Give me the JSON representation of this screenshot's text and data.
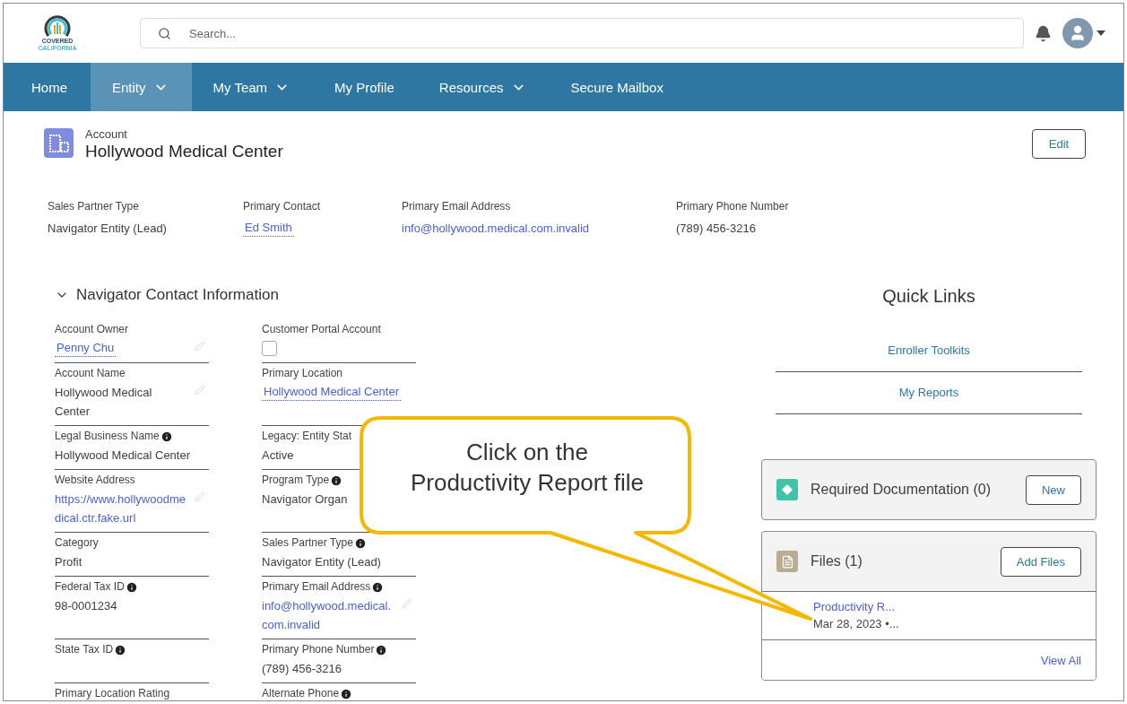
{
  "logo": {
    "line_1": "COVERED",
    "line_2": "CALIFORNIA"
  },
  "search": {
    "placeholder": "Search..."
  },
  "nav": [
    {
      "label": "Home",
      "selected": false,
      "dropdown": false
    },
    {
      "label": "Entity",
      "selected": true,
      "dropdown": true
    },
    {
      "label": "My Team",
      "selected": false,
      "dropdown": true
    },
    {
      "label": "My Profile",
      "selected": false,
      "dropdown": false
    },
    {
      "label": "Resources",
      "selected": false,
      "dropdown": true
    },
    {
      "label": "Secure Mailbox",
      "selected": false,
      "dropdown": false
    }
  ],
  "record": {
    "type": "Account",
    "name": "Hollywood Medical Center",
    "edit_button": "Edit"
  },
  "highlights": [
    {
      "label": "Sales Partner Type",
      "value": "Navigator Entity (Lead)",
      "kind": "text"
    },
    {
      "label": "Primary Contact",
      "value": "Ed Smith",
      "kind": "lookup"
    },
    {
      "label": "Primary Email Address",
      "value": "info@hollywood.medical.com.invalid",
      "kind": "link"
    },
    {
      "label": "Primary Phone Number",
      "value": "(789) 456-3216",
      "kind": "text"
    }
  ],
  "section": {
    "title": "Navigator Contact Information",
    "expanded": true,
    "fields": [
      {
        "label": "Account Owner",
        "value": "Penny Chu",
        "kind": "lookup",
        "info": false,
        "editable": true
      },
      {
        "label": "Customer Portal Account",
        "kind": "checkbox",
        "checked": false,
        "info": false,
        "editable": false
      },
      {
        "label": "Account Name",
        "value": "Hollywood Medical Center",
        "kind": "text",
        "info": false,
        "editable": true
      },
      {
        "label": "Primary Location",
        "value": "Hollywood Medical Center",
        "kind": "lookup",
        "info": false,
        "editable": false
      },
      {
        "label": "Legal Business Name",
        "value": "Hollywood Medical Center",
        "kind": "text",
        "info": true,
        "editable": false
      },
      {
        "label": "Legacy: Entity Stat",
        "value": "Active",
        "kind": "text",
        "info": false,
        "editable": false
      },
      {
        "label": "Website Address",
        "value": "https://www.hollywoodmedical.ctr.fake.url",
        "kind": "link",
        "info": false,
        "editable": true
      },
      {
        "label": "Program Type",
        "value": "Navigator Organ",
        "kind": "text",
        "info": true,
        "editable": false
      },
      {
        "label": "Category",
        "value": "Profit",
        "kind": "text",
        "info": false,
        "editable": false
      },
      {
        "label": "Sales Partner Type",
        "value": "Navigator Entity (Lead)",
        "kind": "text",
        "info": true,
        "editable": false
      },
      {
        "label": "Federal Tax ID",
        "value": "98-0001234",
        "kind": "text",
        "info": true,
        "editable": false
      },
      {
        "label": "Primary Email Address",
        "value": "info@hollywood.medical.com.invalid",
        "kind": "link",
        "info": true,
        "editable": true
      },
      {
        "label": "State Tax ID",
        "kind": "text",
        "info": true,
        "editable": false
      },
      {
        "label": "Primary Phone Number",
        "value": "(789) 456-3216",
        "kind": "text",
        "info": true,
        "editable": false
      },
      {
        "label": "Primary Location Rating",
        "kind": "text",
        "info": false,
        "editable": false
      },
      {
        "label": "Alternate Phone",
        "kind": "text",
        "info": true,
        "editable": false
      }
    ]
  },
  "quick_links": {
    "title": "Quick Links",
    "links": [
      "Enroller Toolkits",
      "My Reports"
    ]
  },
  "required_docs": {
    "title": "Required Documentation (0)",
    "button": "New"
  },
  "files": {
    "title": "Files (1)",
    "button": "Add Files",
    "items": [
      {
        "name": "Productivity R...",
        "meta": "Mar 28, 2023 •..."
      }
    ],
    "view_all": "View All"
  },
  "callout": {
    "lines": [
      "Click on the",
      "Productivity Report file"
    ]
  }
}
